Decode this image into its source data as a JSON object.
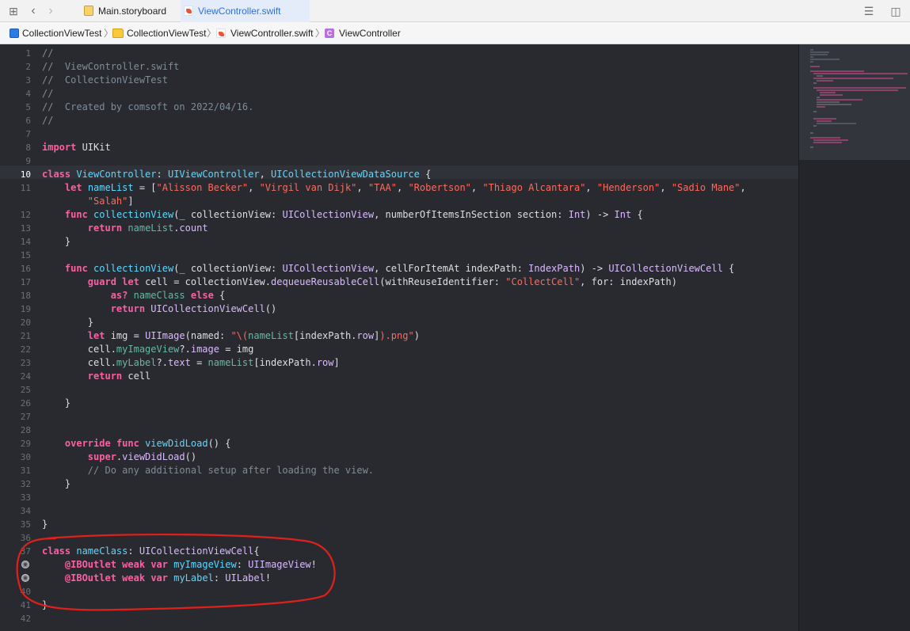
{
  "tabs": [
    {
      "label": "Main.storyboard",
      "icon": "storyboard-file-icon"
    },
    {
      "label": "ViewController.swift",
      "icon": "swift-file-icon",
      "active": true
    }
  ],
  "breadcrumb": [
    {
      "label": "CollectionViewTest",
      "icon": "xcode-project-icon"
    },
    {
      "label": "CollectionViewTest",
      "icon": "folder-icon"
    },
    {
      "label": "ViewController.swift",
      "icon": "swift-file-icon"
    },
    {
      "label": "ViewController",
      "icon": "class-icon"
    }
  ],
  "current_line": 10,
  "lines": [
    {
      "n": "1",
      "code": [
        [
          "c",
          "//"
        ]
      ]
    },
    {
      "n": "2",
      "code": [
        [
          "c",
          "//  ViewController.swift"
        ]
      ]
    },
    {
      "n": "3",
      "code": [
        [
          "c",
          "//  CollectionViewTest"
        ]
      ]
    },
    {
      "n": "4",
      "code": [
        [
          "c",
          "//"
        ]
      ]
    },
    {
      "n": "5",
      "code": [
        [
          "c",
          "//  Created by comsoft on 2022/04/16."
        ]
      ]
    },
    {
      "n": "6",
      "code": [
        [
          "c",
          "//"
        ]
      ]
    },
    {
      "n": "7",
      "code": []
    },
    {
      "n": "8",
      "code": [
        [
          "k",
          "import"
        ],
        [
          "p",
          " UIKit"
        ]
      ]
    },
    {
      "n": "9",
      "code": []
    },
    {
      "n": "10",
      "code": [
        [
          "k",
          "class"
        ],
        [
          "p",
          " "
        ],
        [
          "t",
          "ViewController"
        ],
        [
          "p",
          ": "
        ],
        [
          "t",
          "UIViewController"
        ],
        [
          "p",
          ", "
        ],
        [
          "t",
          "UICollectionViewDataSource"
        ],
        [
          "p",
          " {"
        ]
      ]
    },
    {
      "n": "11",
      "code": [
        [
          "p",
          "    "
        ],
        [
          "k",
          "let"
        ],
        [
          "p",
          " "
        ],
        [
          "t",
          "nameList"
        ],
        [
          "p",
          " = ["
        ],
        [
          "s",
          "\"Alisson Becker\""
        ],
        [
          "p",
          ", "
        ],
        [
          "s",
          "\"Virgil van Dijk\""
        ],
        [
          "p",
          ", "
        ],
        [
          "s",
          "\"TAA\""
        ],
        [
          "p",
          ", "
        ],
        [
          "s",
          "\"Robertson\""
        ],
        [
          "p",
          ", "
        ],
        [
          "s",
          "\"Thiago Alcantara\""
        ],
        [
          "p",
          ", "
        ],
        [
          "s",
          "\"Henderson\""
        ],
        [
          "p",
          ", "
        ],
        [
          "s",
          "\"Sadio Mane\""
        ],
        [
          "p",
          ","
        ]
      ]
    },
    {
      "n": "",
      "code": [
        [
          "p",
          "        "
        ],
        [
          "s",
          "\"Salah\""
        ],
        [
          "p",
          "]"
        ]
      ]
    },
    {
      "n": "12",
      "code": [
        [
          "p",
          "    "
        ],
        [
          "k",
          "func"
        ],
        [
          "p",
          " "
        ],
        [
          "t",
          "collectionView"
        ],
        [
          "p",
          "(_ collectionView: "
        ],
        [
          "o",
          "UICollectionView"
        ],
        [
          "p",
          ", numberOfItemsInSection section: "
        ],
        [
          "o",
          "Int"
        ],
        [
          "p",
          ") -> "
        ],
        [
          "o",
          "Int"
        ],
        [
          "p",
          " {"
        ]
      ]
    },
    {
      "n": "13",
      "code": [
        [
          "p",
          "        "
        ],
        [
          "k",
          "return"
        ],
        [
          "p",
          " "
        ],
        [
          "f",
          "nameList"
        ],
        [
          "p",
          "."
        ],
        [
          "o",
          "count"
        ]
      ]
    },
    {
      "n": "14",
      "code": [
        [
          "p",
          "    }"
        ]
      ]
    },
    {
      "n": "15",
      "code": []
    },
    {
      "n": "16",
      "code": [
        [
          "p",
          "    "
        ],
        [
          "k",
          "func"
        ],
        [
          "p",
          " "
        ],
        [
          "t",
          "collectionView"
        ],
        [
          "p",
          "(_ collectionView: "
        ],
        [
          "o",
          "UICollectionView"
        ],
        [
          "p",
          ", cellForItemAt indexPath: "
        ],
        [
          "o",
          "IndexPath"
        ],
        [
          "p",
          ") -> "
        ],
        [
          "o",
          "UICollectionViewCell"
        ],
        [
          "p",
          " {"
        ]
      ]
    },
    {
      "n": "17",
      "code": [
        [
          "p",
          "        "
        ],
        [
          "k",
          "guard"
        ],
        [
          "p",
          " "
        ],
        [
          "k",
          "let"
        ],
        [
          "p",
          " cell = collectionView."
        ],
        [
          "o",
          "dequeueReusableCell"
        ],
        [
          "p",
          "(withReuseIdentifier: "
        ],
        [
          "s",
          "\"CollectCell\""
        ],
        [
          "p",
          ", for: indexPath)"
        ]
      ]
    },
    {
      "n": "18",
      "code": [
        [
          "p",
          "            "
        ],
        [
          "k",
          "as?"
        ],
        [
          "p",
          " "
        ],
        [
          "f",
          "nameClass"
        ],
        [
          "p",
          " "
        ],
        [
          "k",
          "else"
        ],
        [
          "p",
          " {"
        ]
      ]
    },
    {
      "n": "19",
      "code": [
        [
          "p",
          "            "
        ],
        [
          "k",
          "return"
        ],
        [
          "p",
          " "
        ],
        [
          "o",
          "UICollectionViewCell"
        ],
        [
          "p",
          "()"
        ]
      ]
    },
    {
      "n": "20",
      "code": [
        [
          "p",
          "        }"
        ]
      ]
    },
    {
      "n": "21",
      "code": [
        [
          "p",
          "        "
        ],
        [
          "k",
          "let"
        ],
        [
          "p",
          " img = "
        ],
        [
          "o",
          "UIImage"
        ],
        [
          "p",
          "(named: "
        ],
        [
          "s",
          "\"\\("
        ],
        [
          "f",
          "nameList"
        ],
        [
          "p",
          "[indexPath."
        ],
        [
          "o",
          "row"
        ],
        [
          "p",
          "]"
        ],
        [
          "s",
          ").png\""
        ],
        [
          "p",
          ")"
        ]
      ]
    },
    {
      "n": "22",
      "code": [
        [
          "p",
          "        cell."
        ],
        [
          "f",
          "myImageView"
        ],
        [
          "p",
          "?."
        ],
        [
          "o",
          "image"
        ],
        [
          "p",
          " = img"
        ]
      ]
    },
    {
      "n": "23",
      "code": [
        [
          "p",
          "        cell."
        ],
        [
          "f",
          "myLabel"
        ],
        [
          "p",
          "?."
        ],
        [
          "o",
          "text"
        ],
        [
          "p",
          " = "
        ],
        [
          "f",
          "nameList"
        ],
        [
          "p",
          "[indexPath."
        ],
        [
          "o",
          "row"
        ],
        [
          "p",
          "]"
        ]
      ]
    },
    {
      "n": "24",
      "code": [
        [
          "p",
          "        "
        ],
        [
          "k",
          "return"
        ],
        [
          "p",
          " cell"
        ]
      ]
    },
    {
      "n": "25",
      "code": []
    },
    {
      "n": "26",
      "code": [
        [
          "p",
          "    }"
        ]
      ]
    },
    {
      "n": "27",
      "code": []
    },
    {
      "n": "28",
      "code": []
    },
    {
      "n": "29",
      "code": [
        [
          "p",
          "    "
        ],
        [
          "k",
          "override"
        ],
        [
          "p",
          " "
        ],
        [
          "k",
          "func"
        ],
        [
          "p",
          " "
        ],
        [
          "t",
          "viewDidLoad"
        ],
        [
          "p",
          "() {"
        ]
      ]
    },
    {
      "n": "30",
      "code": [
        [
          "p",
          "        "
        ],
        [
          "k",
          "super"
        ],
        [
          "p",
          "."
        ],
        [
          "o",
          "viewDidLoad"
        ],
        [
          "p",
          "()"
        ]
      ]
    },
    {
      "n": "31",
      "code": [
        [
          "c",
          "        // Do any additional setup after loading the view."
        ]
      ]
    },
    {
      "n": "32",
      "code": [
        [
          "p",
          "    }"
        ]
      ]
    },
    {
      "n": "33",
      "code": []
    },
    {
      "n": "34",
      "code": []
    },
    {
      "n": "35",
      "code": [
        [
          "p",
          "}"
        ]
      ]
    },
    {
      "n": "36",
      "code": []
    },
    {
      "n": "37",
      "code": [
        [
          "k",
          "class"
        ],
        [
          "p",
          " "
        ],
        [
          "t",
          "nameClass"
        ],
        [
          "p",
          ": "
        ],
        [
          "o",
          "UICollectionViewCell"
        ],
        [
          "p",
          "{"
        ]
      ]
    },
    {
      "n": "",
      "outlet": true,
      "code": [
        [
          "p",
          "    "
        ],
        [
          "k",
          "@IBOutlet"
        ],
        [
          "p",
          " "
        ],
        [
          "k",
          "weak"
        ],
        [
          "p",
          " "
        ],
        [
          "k",
          "var"
        ],
        [
          "p",
          " "
        ],
        [
          "t",
          "myImageView"
        ],
        [
          "p",
          ": "
        ],
        [
          "o",
          "UIImageView"
        ],
        [
          "p",
          "!"
        ]
      ]
    },
    {
      "n": "",
      "outlet": true,
      "code": [
        [
          "p",
          "    "
        ],
        [
          "k",
          "@IBOutlet"
        ],
        [
          "p",
          " "
        ],
        [
          "k",
          "weak"
        ],
        [
          "p",
          " "
        ],
        [
          "k",
          "var"
        ],
        [
          "p",
          " "
        ],
        [
          "t",
          "myLabel"
        ],
        [
          "p",
          ": "
        ],
        [
          "o",
          "UILabel"
        ],
        [
          "p",
          "!"
        ]
      ]
    },
    {
      "n": "40",
      "code": []
    },
    {
      "n": "41",
      "code": [
        [
          "p",
          "}"
        ]
      ]
    },
    {
      "n": "42",
      "code": []
    }
  ],
  "colors": {
    "editor_bg": "#292a30",
    "keyword": "#fc5fa3",
    "string": "#fc6a5d",
    "comment": "#7f8c98",
    "annotation_stroke": "#e0201a"
  }
}
